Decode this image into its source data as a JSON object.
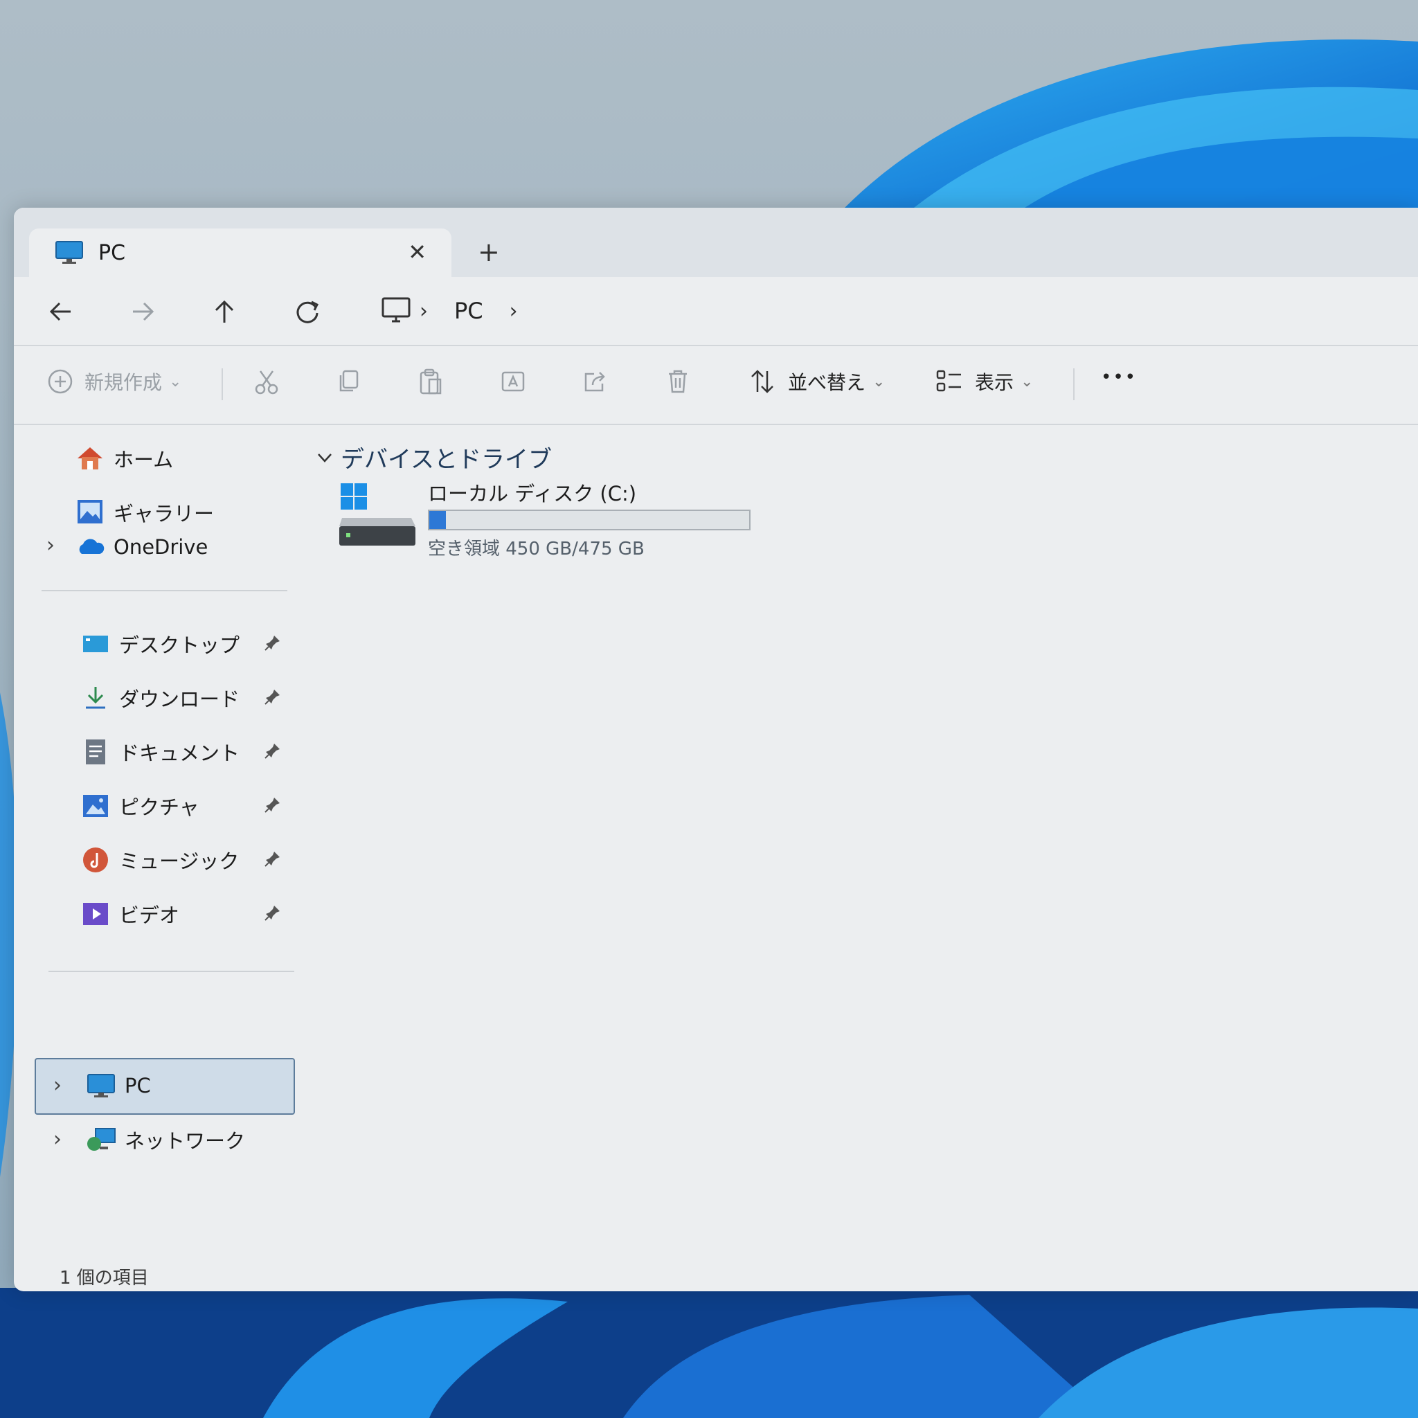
{
  "tab": {
    "title": "PC",
    "close_glyph": "✕",
    "new_glyph": "+"
  },
  "breadcrumb": {
    "current": "PC",
    "sep": "›",
    "icon": "monitor-icon"
  },
  "commandbar": {
    "new_label": "新規作成",
    "sort_label": "並べ替え",
    "view_label": "表示",
    "more": "•••",
    "dropdown": "⌄"
  },
  "sidebar": {
    "home": "ホーム",
    "gallery": "ギャラリー",
    "onedrive": "OneDrive",
    "pinned": [
      {
        "label": "デスクトップ",
        "icon": "desktop-folder-icon"
      },
      {
        "label": "ダウンロード",
        "icon": "download-icon"
      },
      {
        "label": "ドキュメント",
        "icon": "document-icon"
      },
      {
        "label": "ピクチャ",
        "icon": "pictures-icon"
      },
      {
        "label": "ミュージック",
        "icon": "music-icon"
      },
      {
        "label": "ビデオ",
        "icon": "video-icon"
      }
    ],
    "pc": "PC",
    "network": "ネットワーク",
    "expand_glyph": "›"
  },
  "main": {
    "section_title": "デバイスとドライブ",
    "drive": {
      "name": "ローカル ディスク (C:)",
      "free_text": "空き領域 450 GB/475 GB",
      "used_fraction": 0.053
    }
  },
  "status": {
    "count": "1 個の項目"
  },
  "colors": {
    "accent": "#2d78d6",
    "selection": "#cfdce8",
    "window_bg": "#eceef0"
  }
}
